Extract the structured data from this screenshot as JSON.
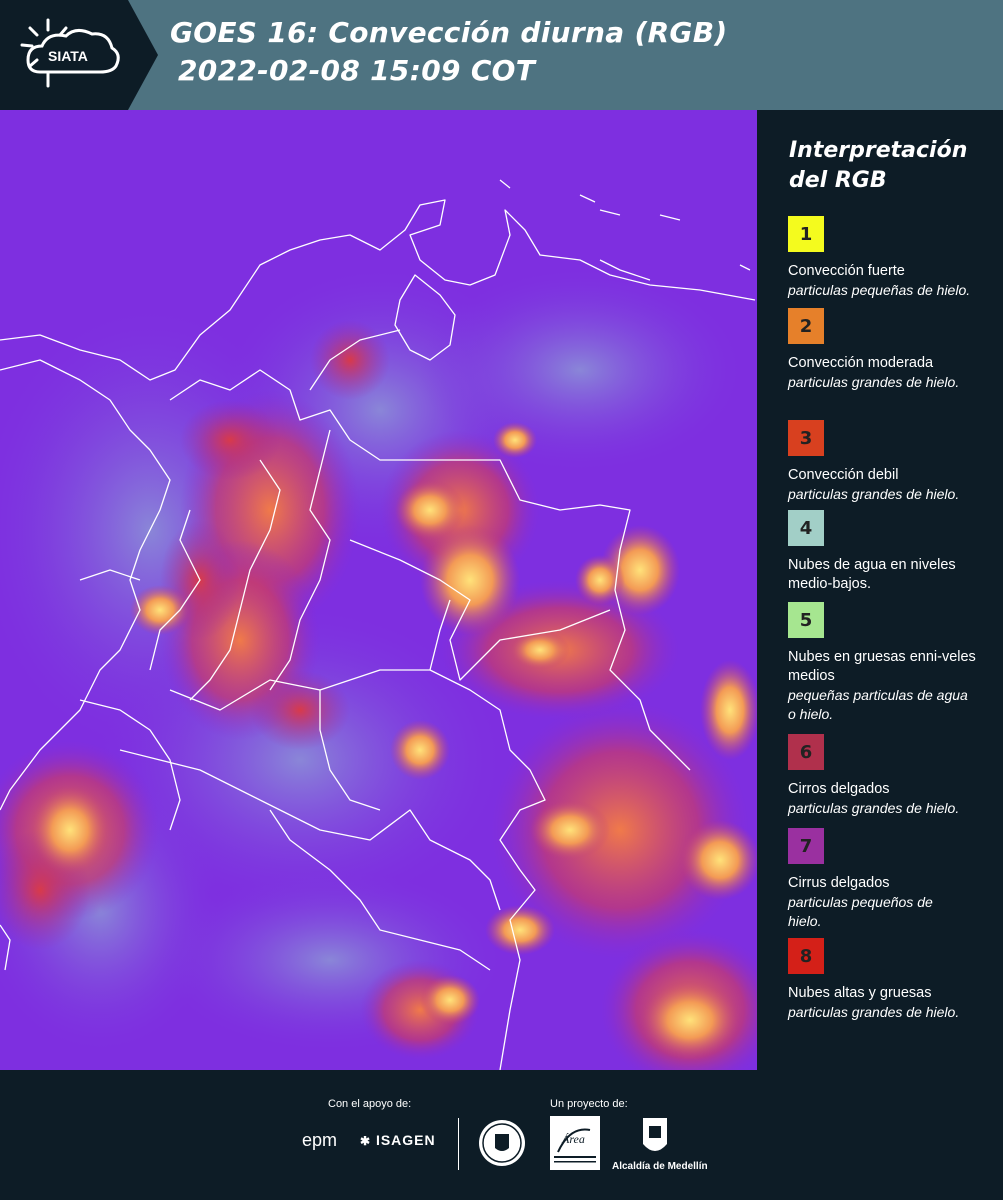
{
  "header": {
    "logo_text": "SIATA",
    "title_line1": "GOES 16: Convección diurna (RGB)",
    "title_line2": "2022-02-08 15:09 COT"
  },
  "legend": {
    "title": "Interpretación del RGB",
    "items": [
      {
        "number": "1",
        "color": "#f4fb1e",
        "label": "Convección fuerte",
        "desc": "particulas pequeñas de hielo."
      },
      {
        "number": "2",
        "color": "#e6802a",
        "label": "Convección moderada",
        "desc": "particulas grandes de hielo."
      },
      {
        "number": "3",
        "color": "#d8401f",
        "label": "Convección debil",
        "desc": "particulas grandes de hielo."
      },
      {
        "number": "4",
        "color": "#a2cfc7",
        "label": "Nubes de agua en niveles medio-bajos.",
        "desc": ""
      },
      {
        "number": "5",
        "color": "#a6e690",
        "label": "Nubes en gruesas enni-veles medios",
        "desc": "pequeñas particulas de agua o hielo."
      },
      {
        "number": "6",
        "color": "#b0304c",
        "label": "Cirros delgados",
        "desc": "particulas grandes de hielo."
      },
      {
        "number": "7",
        "color": "#9a30a0",
        "label": "Cirrus delgados",
        "desc": "particulas pequeños de hielo."
      },
      {
        "number": "8",
        "color": "#d42018",
        "label": "Nubes altas y gruesas",
        "desc": "particulas grandes de hielo."
      }
    ]
  },
  "footer": {
    "support_label": "Con el apoyo de:",
    "project_label": "Un proyecto de:",
    "epm": "epm",
    "isagen": "ISAGEN",
    "area_metro": "Área",
    "alcaldia": "Alcaldía de Medellín"
  }
}
